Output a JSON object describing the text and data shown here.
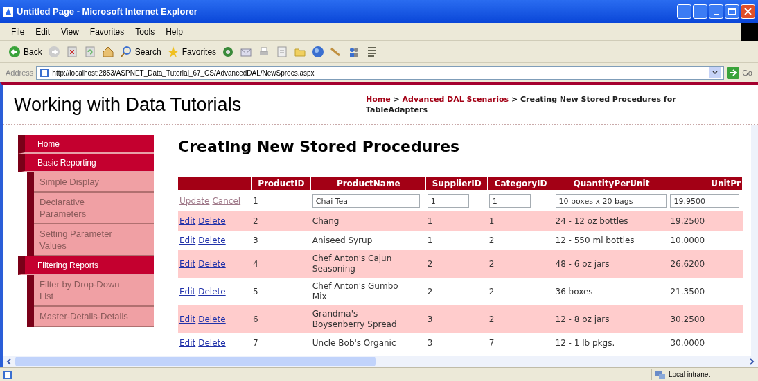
{
  "window": {
    "title": "Untitled Page - Microsoft Internet Explorer"
  },
  "menu": [
    "File",
    "Edit",
    "View",
    "Favorites",
    "Tools",
    "Help"
  ],
  "toolbar": [
    {
      "kind": "back",
      "label": "Back"
    },
    {
      "kind": "forward"
    },
    {
      "kind": "stop"
    },
    {
      "kind": "refresh"
    },
    {
      "kind": "home"
    },
    {
      "kind": "search",
      "label": "Search"
    },
    {
      "kind": "favorites",
      "label": "Favorites"
    },
    {
      "kind": "media"
    },
    {
      "kind": "mail"
    },
    {
      "kind": "print"
    },
    {
      "kind": "edit"
    },
    {
      "kind": "folder"
    },
    {
      "kind": "globe"
    },
    {
      "kind": "pen"
    },
    {
      "kind": "people"
    },
    {
      "kind": "notes"
    }
  ],
  "address": {
    "label": "Address",
    "url": "http://localhost:2853/ASPNET_Data_Tutorial_67_CS/AdvancedDAL/NewSprocs.aspx",
    "go": "Go"
  },
  "site": {
    "title": "Working with Data Tutorials",
    "breadcrumb": [
      {
        "text": "Home",
        "link": true
      },
      {
        "text": ">",
        "link": false
      },
      {
        "text": "Advanced DAL Scenarios",
        "link": true
      },
      {
        "text": "> Creating New Stored Procedures for TableAdapters",
        "link": false
      }
    ]
  },
  "sidebar": {
    "items": [
      {
        "label": "Home"
      },
      {
        "label": "Basic Reporting",
        "children": [
          {
            "label": "Simple Display"
          },
          {
            "label": "Declarative Parameters"
          },
          {
            "label": "Setting Parameter Values"
          }
        ]
      },
      {
        "label": "Filtering Reports",
        "children": [
          {
            "label": "Filter by Drop-Down List"
          },
          {
            "label": "Master-Details-Details"
          }
        ]
      }
    ]
  },
  "heading": "Creating New Stored Procedures",
  "table": {
    "columns": [
      "ProductID",
      "ProductName",
      "SupplierID",
      "CategoryID",
      "QuantityPerUnit",
      "UnitPr"
    ],
    "rows": [
      {
        "editing": true,
        "actions": [
          "Update",
          "Cancel"
        ],
        "cells": [
          "1",
          "Chai Tea",
          "1",
          "1",
          "10 boxes x 20 bags",
          "19.9500"
        ]
      },
      {
        "editing": false,
        "actions": [
          "Edit",
          "Delete"
        ],
        "cells": [
          "2",
          "Chang",
          "1",
          "1",
          "24 - 12 oz bottles",
          "19.2500"
        ]
      },
      {
        "editing": false,
        "actions": [
          "Edit",
          "Delete"
        ],
        "cells": [
          "3",
          "Aniseed Syrup",
          "1",
          "2",
          "12 - 550 ml bottles",
          "10.0000"
        ]
      },
      {
        "editing": false,
        "actions": [
          "Edit",
          "Delete"
        ],
        "cells": [
          "4",
          "Chef Anton's Cajun Seasoning",
          "2",
          "2",
          "48 - 6 oz jars",
          "26.6200"
        ]
      },
      {
        "editing": false,
        "actions": [
          "Edit",
          "Delete"
        ],
        "cells": [
          "5",
          "Chef Anton's Gumbo Mix",
          "2",
          "2",
          "36 boxes",
          "21.3500"
        ]
      },
      {
        "editing": false,
        "actions": [
          "Edit",
          "Delete"
        ],
        "cells": [
          "6",
          "Grandma's Boysenberry Spread",
          "3",
          "2",
          "12 - 8 oz jars",
          "30.2500"
        ]
      },
      {
        "editing": false,
        "actions": [
          "Edit",
          "Delete"
        ],
        "cells": [
          "7",
          "Uncle Bob's Organic",
          "3",
          "7",
          "12 - 1 lb pkgs.",
          "30.0000"
        ]
      }
    ]
  },
  "status_bar": {
    "zone": "Local intranet"
  }
}
